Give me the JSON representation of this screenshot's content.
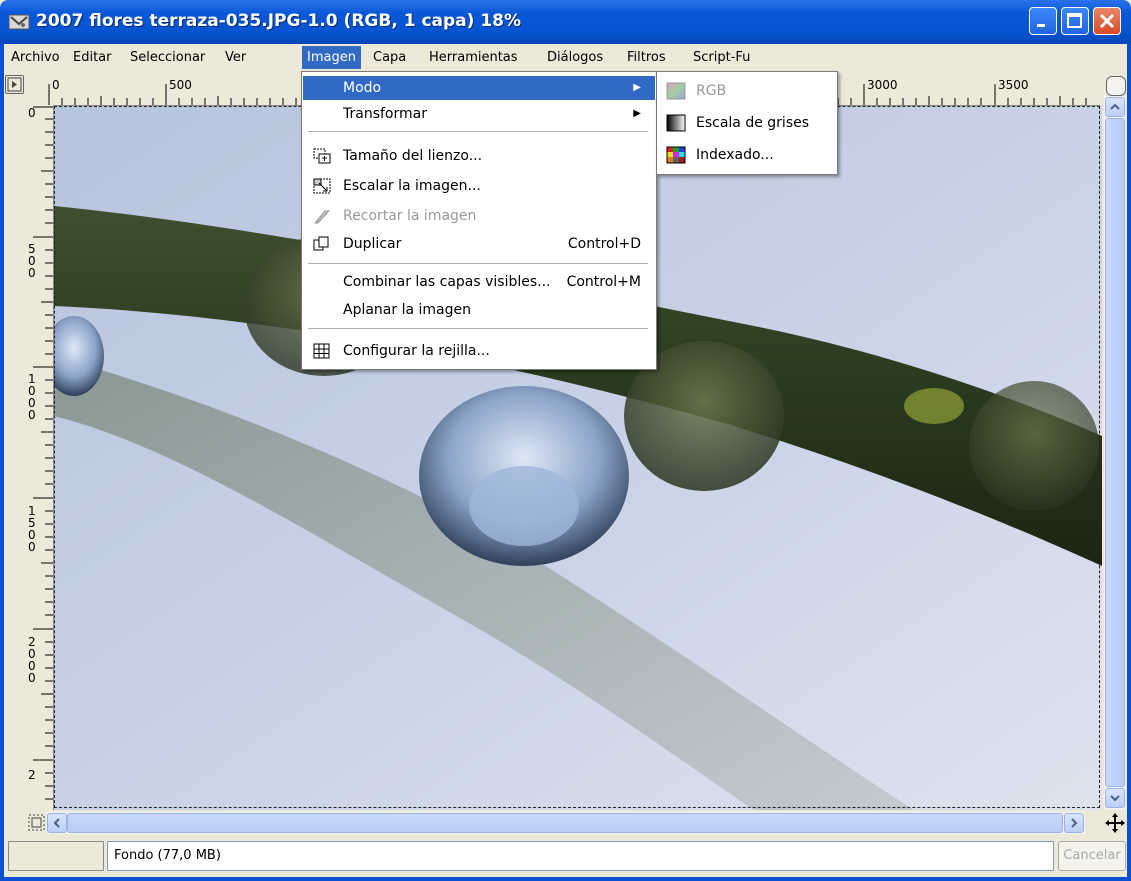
{
  "window": {
    "title": "2007 flores terraza-035.JPG-1.0 (RGB, 1 capa) 18%"
  },
  "menubar": {
    "items": [
      {
        "label": "Archivo"
      },
      {
        "label": "Editar"
      },
      {
        "label": "Seleccionar"
      },
      {
        "label": "Ver"
      },
      {
        "label": "Imagen"
      },
      {
        "label": "Capa"
      },
      {
        "label": "Herramientas"
      },
      {
        "label": "Diálogos"
      },
      {
        "label": "Filtros"
      },
      {
        "label": "Script-Fu"
      }
    ],
    "active": "Imagen"
  },
  "ruler": {
    "horizontal": [
      "0",
      "500",
      "3000",
      "3500"
    ],
    "vertical": [
      "0",
      "5\n0\n0",
      "1\n0\n0\n0",
      "1\n5\n0\n0",
      "2\n0\n0\n0",
      "2"
    ]
  },
  "image_menu": {
    "items": [
      {
        "label": "Modo",
        "submenu": true,
        "highlighted": true
      },
      {
        "label": "Transformar",
        "submenu": true
      },
      {
        "label": "Tamaño del lienzo...",
        "icon": "canvas-size-icon"
      },
      {
        "label": "Escalar la imagen...",
        "icon": "scale-image-icon"
      },
      {
        "label": "Recortar la imagen",
        "icon": "crop-icon",
        "disabled": true
      },
      {
        "label": "Duplicar",
        "icon": "duplicate-icon",
        "shortcut": "Control+D"
      },
      {
        "label": "Combinar las capas visibles...",
        "shortcut": "Control+M"
      },
      {
        "label": "Aplanar la imagen"
      },
      {
        "label": "Configurar la rejilla...",
        "icon": "grid-icon"
      }
    ]
  },
  "mode_submenu": {
    "items": [
      {
        "label": "RGB",
        "disabled": true,
        "icon": "rgb-icon"
      },
      {
        "label": "Escala de grises",
        "icon": "grayscale-icon"
      },
      {
        "label": "Indexado...",
        "icon": "indexed-icon"
      }
    ]
  },
  "statusbar": {
    "layer_info": "Fondo (77,0 MB)",
    "cancel_label": "Cancelar"
  },
  "colors": {
    "titlebar": "#0554d0",
    "menu_highlight": "#316ac5"
  }
}
